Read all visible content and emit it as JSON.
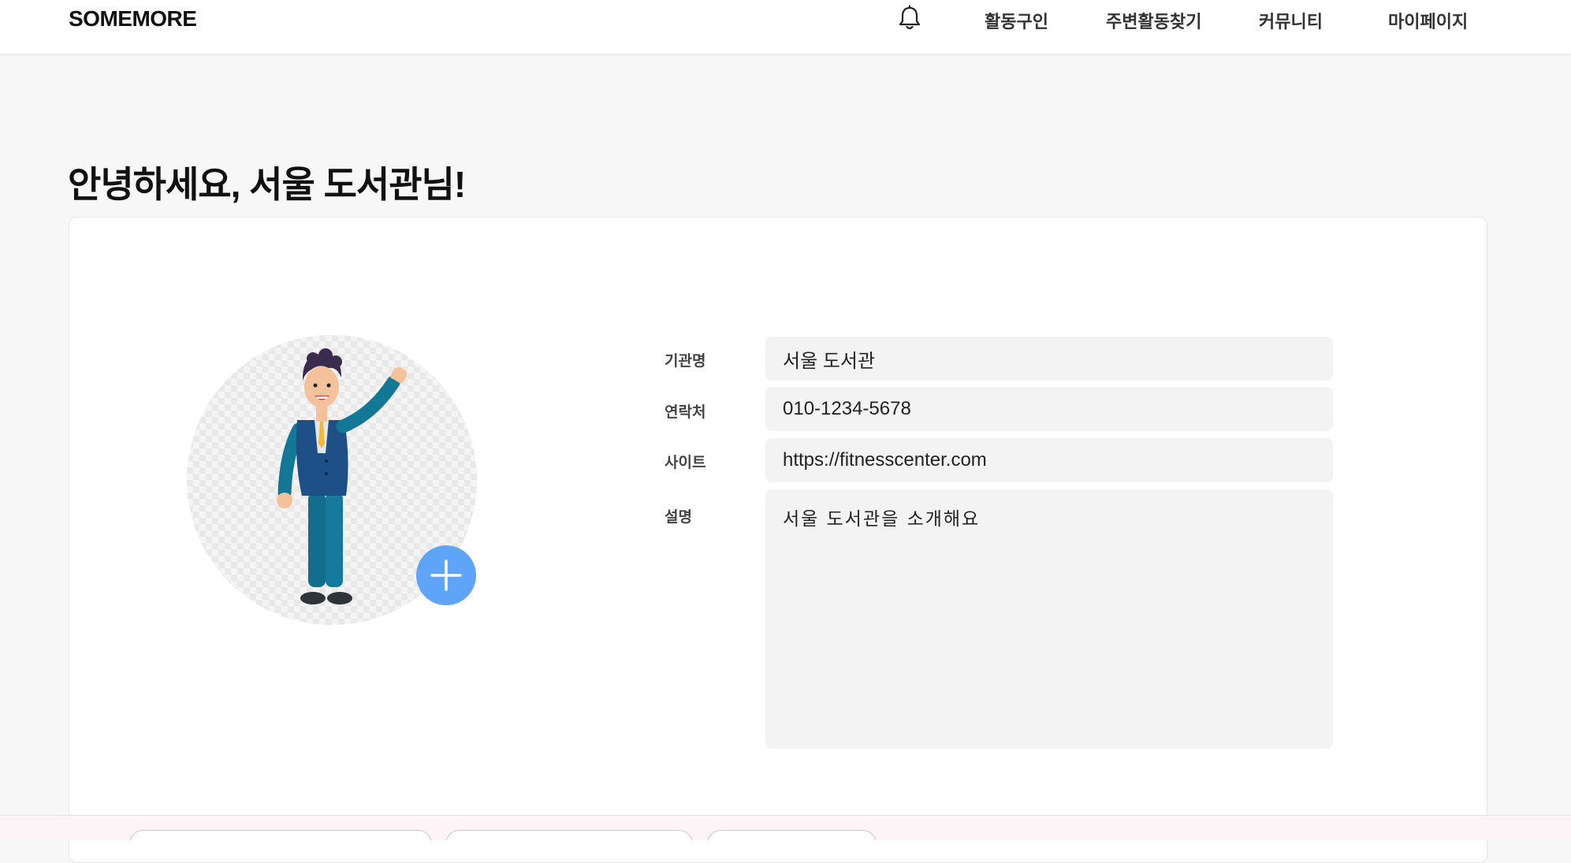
{
  "header": {
    "logo": "SOMEMORE",
    "nav": [
      {
        "label": "활동구인"
      },
      {
        "label": "주변활동찾기"
      },
      {
        "label": "커뮤니티"
      },
      {
        "label": "마이페이지"
      }
    ]
  },
  "greeting": "안녕하세요, 서울 도서관님!",
  "profile": {
    "fields": {
      "name": {
        "label": "기관명",
        "value": "서울 도서관"
      },
      "contact": {
        "label": "연락처",
        "value": "010-1234-5678"
      },
      "site": {
        "label": "사이트",
        "value": "https://fitnesscenter.com"
      },
      "description": {
        "label": "설명",
        "value": "서울 도서관을 소개해요"
      }
    }
  },
  "colors": {
    "accent": "#5ea4f8",
    "page_bg": "#f7f7f7",
    "input_bg": "#f3f3f3"
  },
  "icons": {
    "notification": "bell-icon",
    "add_photo": "plus-icon"
  }
}
